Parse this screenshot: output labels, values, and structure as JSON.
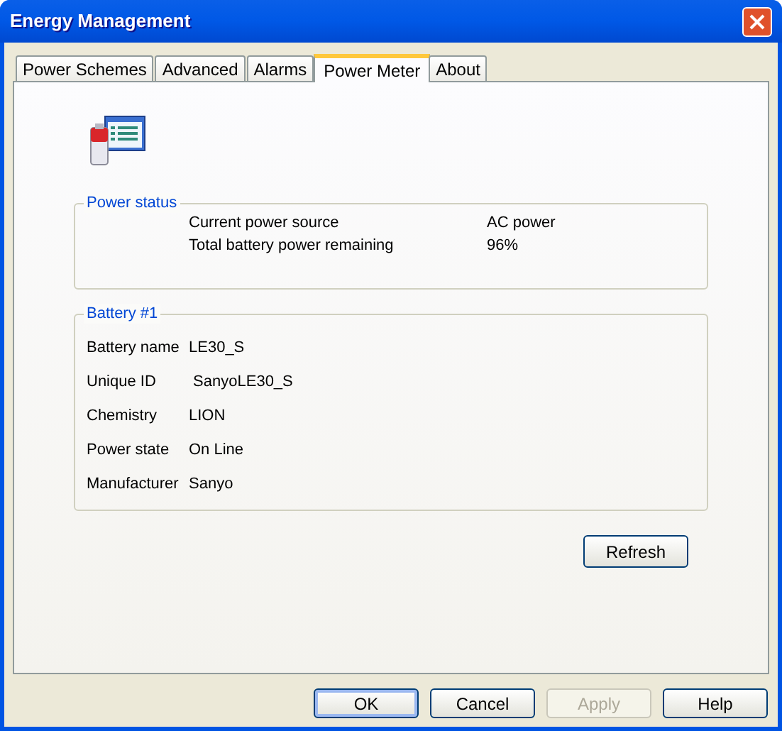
{
  "window": {
    "title": "Energy Management"
  },
  "tabs": [
    {
      "label": "Power Schemes",
      "selected": false
    },
    {
      "label": "Advanced",
      "selected": false
    },
    {
      "label": "Alarms",
      "selected": false
    },
    {
      "label": "Power Meter",
      "selected": true
    },
    {
      "label": "About",
      "selected": false
    }
  ],
  "power_status": {
    "title": "Power status",
    "rows": [
      {
        "label": "Current power source",
        "value": "AC power"
      },
      {
        "label": "Total battery power remaining",
        "value": "96%"
      }
    ]
  },
  "battery": {
    "title": "Battery #1",
    "rows": [
      {
        "label": "Battery name",
        "value": "LE30_S"
      },
      {
        "label": "Unique ID",
        "value": " SanyoLE30_S"
      },
      {
        "label": "Chemistry",
        "value": "LION"
      },
      {
        "label": "Power state",
        "value": "On Line"
      },
      {
        "label": "Manufacturer",
        "value": "Sanyo"
      }
    ]
  },
  "refresh_button": {
    "label": "Refresh"
  },
  "buttons": [
    {
      "label": "OK",
      "default": true,
      "disabled": false
    },
    {
      "label": "Cancel",
      "default": false,
      "disabled": false
    },
    {
      "label": "Apply",
      "default": false,
      "disabled": true
    },
    {
      "label": "Help",
      "default": false,
      "disabled": false
    }
  ]
}
